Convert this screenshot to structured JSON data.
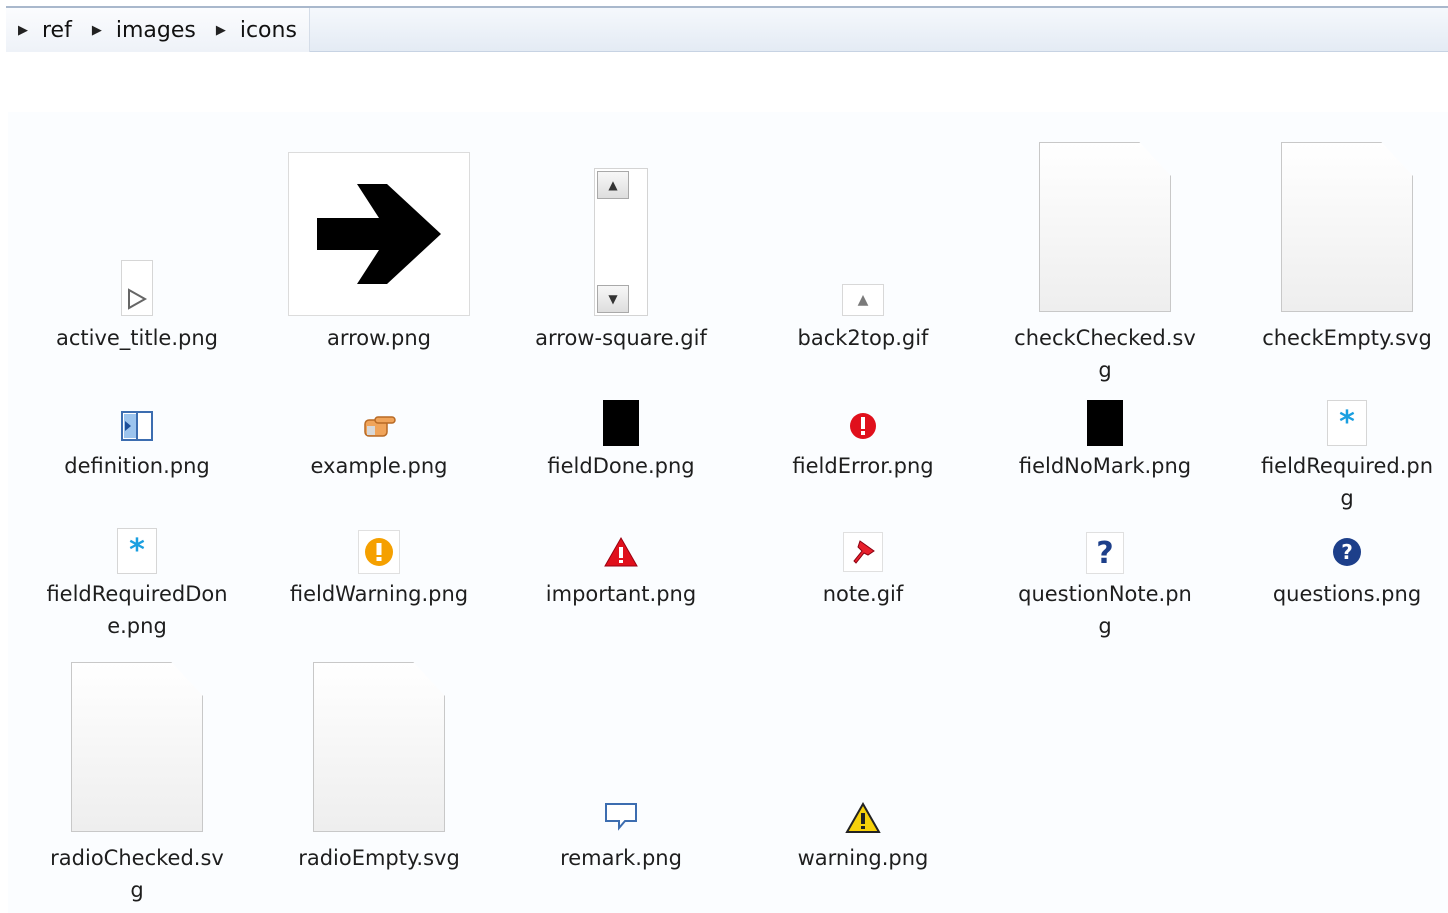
{
  "breadcrumb": {
    "items": [
      {
        "label": "ref"
      },
      {
        "label": "images"
      },
      {
        "label": "icons"
      }
    ]
  },
  "files": [
    {
      "name1": "active_title.png",
      "name2": "",
      "thumb": "play-triangle-icon"
    },
    {
      "name1": "arrow.png",
      "name2": "",
      "thumb": "right-arrow-icon"
    },
    {
      "name1": "arrow-square.gif",
      "name2": "",
      "thumb": "scrollbar-arrows-icon"
    },
    {
      "name1": "back2top.gif",
      "name2": "",
      "thumb": "up-triangle-icon"
    },
    {
      "name1": "checkChecked.sv",
      "name2": "g",
      "thumb": "blank-document-icon"
    },
    {
      "name1": "checkEmpty.svg",
      "name2": "",
      "thumb": "blank-document-icon"
    },
    {
      "name1": "definition.png",
      "name2": "",
      "thumb": "book-icon"
    },
    {
      "name1": "example.png",
      "name2": "",
      "thumb": "pointing-hand-icon"
    },
    {
      "name1": "fieldDone.png",
      "name2": "",
      "thumb": "black-square-icon"
    },
    {
      "name1": "fieldError.png",
      "name2": "",
      "thumb": "error-icon"
    },
    {
      "name1": "fieldNoMark.png",
      "name2": "",
      "thumb": "black-square-icon"
    },
    {
      "name1": "fieldRequired.pn",
      "name2": "g",
      "thumb": "asterisk-icon"
    },
    {
      "name1": "fieldRequiredDon",
      "name2": "e.png",
      "thumb": "asterisk-icon"
    },
    {
      "name1": "fieldWarning.png",
      "name2": "",
      "thumb": "warning-circle-icon"
    },
    {
      "name1": "important.png",
      "name2": "",
      "thumb": "alert-triangle-icon"
    },
    {
      "name1": "note.gif",
      "name2": "",
      "thumb": "pushpin-icon"
    },
    {
      "name1": "questionNote.pn",
      "name2": "g",
      "thumb": "question-mark-icon"
    },
    {
      "name1": "questions.png",
      "name2": "",
      "thumb": "question-circle-icon"
    },
    {
      "name1": "radioChecked.sv",
      "name2": "g",
      "thumb": "blank-document-icon"
    },
    {
      "name1": "radioEmpty.svg",
      "name2": "",
      "thumb": "blank-document-icon"
    },
    {
      "name1": "remark.png",
      "name2": "",
      "thumb": "speech-bubble-icon"
    },
    {
      "name1": "warning.png",
      "name2": "",
      "thumb": "warning-triangle-icon"
    }
  ],
  "colors": {
    "error_red": "#e0101c",
    "asterisk_blue": "#1a9fe0",
    "warning_orange": "#f5a000",
    "question_navy": "#1d3f8a",
    "warning_yellow": "#f7d10a"
  }
}
